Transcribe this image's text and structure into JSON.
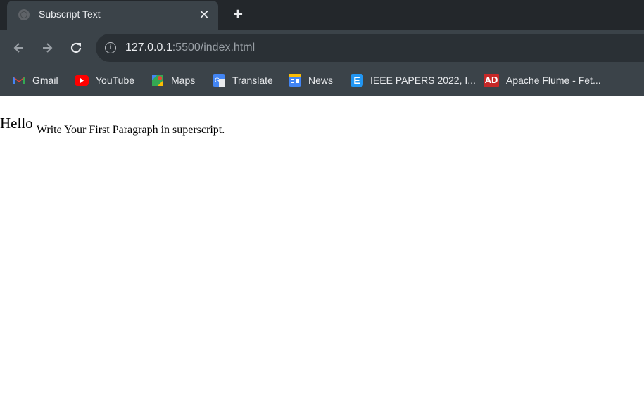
{
  "tab": {
    "title": "Subscript Text",
    "close_glyph": "✕",
    "new_tab_glyph": "+"
  },
  "toolbar": {
    "back_icon": "arrow-left-icon",
    "forward_icon": "arrow-right-icon",
    "reload_icon": "reload-icon",
    "url_host": "127.0.0.1",
    "url_path": ":5500/index.html"
  },
  "bookmarks": [
    {
      "label": "Gmail",
      "icon": "gmail-icon",
      "color": "#ea4335"
    },
    {
      "label": "YouTube",
      "icon": "youtube-icon",
      "color": "#ff0000"
    },
    {
      "label": "Maps",
      "icon": "maps-icon",
      "color": "#34a853"
    },
    {
      "label": "Translate",
      "icon": "translate-icon",
      "color": "#4285f4"
    },
    {
      "label": "News",
      "icon": "news-icon",
      "color": "#4285f4"
    },
    {
      "label": "IEEE PAPERS 2022, I...",
      "icon": "ieee-icon",
      "color": "#2196f3"
    },
    {
      "label": "Apache Flume - Fet...",
      "icon": "apache-flume-icon",
      "color": "#c62828"
    }
  ],
  "page": {
    "main_text": "Hello",
    "sub_text": "Write Your First Paragraph in superscript."
  }
}
